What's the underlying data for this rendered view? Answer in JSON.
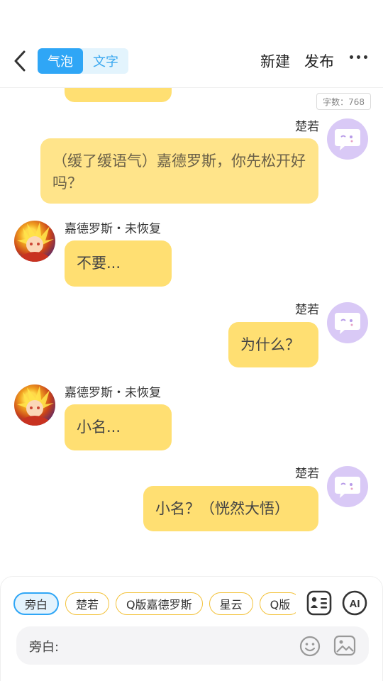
{
  "header": {
    "tabs": [
      {
        "label": "气泡",
        "active": true
      },
      {
        "label": "文字",
        "active": false
      }
    ],
    "new_label": "新建",
    "publish_label": "发布",
    "more_icon": "more-horizontal-icon"
  },
  "chat": {
    "word_count": "字数：768",
    "messages": [
      {
        "side": "left",
        "name": "",
        "text": "",
        "partial": true
      },
      {
        "side": "right",
        "name": "楚若",
        "text": "（缓了缓语气）嘉德罗斯，你先松开好吗？"
      },
      {
        "side": "left",
        "name": "嘉德罗斯・未恢复",
        "text": "不要..."
      },
      {
        "side": "right",
        "name": "楚若",
        "text": "为什么？"
      },
      {
        "side": "left",
        "name": "嘉德罗斯・未恢复",
        "text": "小名..."
      },
      {
        "side": "right",
        "name": "楚若",
        "text": "小名？（恍然大悟）"
      }
    ]
  },
  "composer": {
    "chips": [
      "旁白",
      "楚若",
      "Q版嘉德罗斯",
      "星云",
      "Q版"
    ],
    "active_chip": "旁白",
    "input_label": "旁白:",
    "input_value": "",
    "input_placeholder": ""
  },
  "colors": {
    "accent": "#2fa6f6",
    "bubble": "#ffdf72",
    "bot_avatar": "#d9c9f6"
  }
}
